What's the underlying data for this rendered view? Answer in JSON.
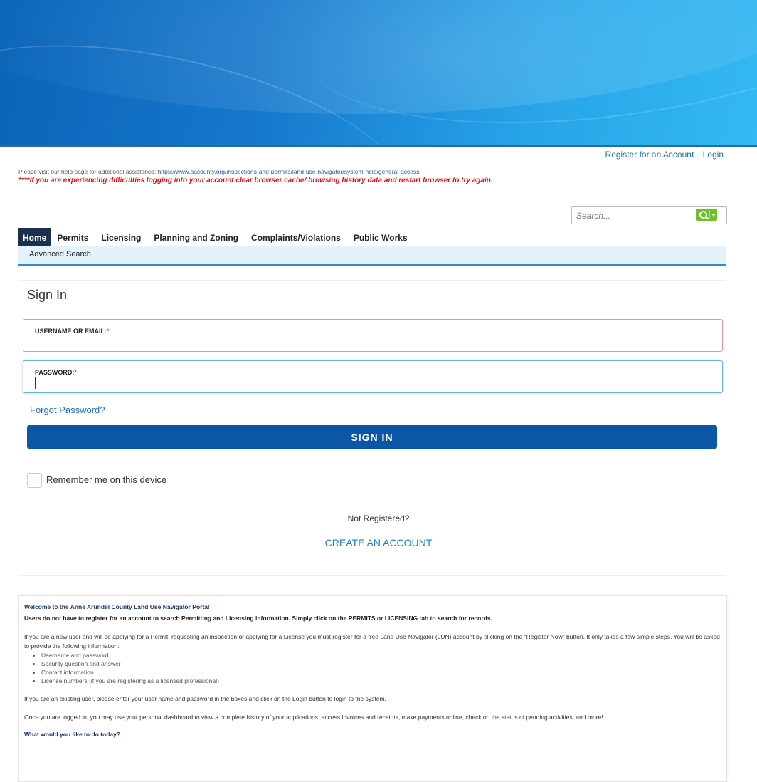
{
  "header": {
    "register_link": "Register for an Account",
    "login_link": "Login"
  },
  "help": {
    "text": "Please visit our help page for additional assistance:",
    "url_text": "https://www.aacounty.org/inspections-and-permits/land-use-navigator/system-help/general-access",
    "warning": "****If you are experiencing difficulties logging into your account clear browser cache/ browsing history data and restart browser to try again."
  },
  "search": {
    "placeholder": "Search...",
    "button_icon": "search-icon"
  },
  "nav": {
    "tabs": [
      {
        "label": "Home",
        "active": true
      },
      {
        "label": "Permits",
        "active": false
      },
      {
        "label": "Licensing",
        "active": false
      },
      {
        "label": "Planning and Zoning",
        "active": false
      },
      {
        "label": "Complaints/Violations",
        "active": false
      },
      {
        "label": "Public Works",
        "active": false
      }
    ],
    "subnav_item": "Advanced Search"
  },
  "signin": {
    "title": "Sign In",
    "username_label": "USERNAME OR EMAIL:",
    "password_label": "PASSWORD:",
    "required_mark": "*",
    "username_value": "",
    "password_value": "",
    "forgot_link": "Forgot Password?",
    "button_label": "SIGN IN",
    "remember_label": "Remember me on this device",
    "remember_checked": false,
    "not_registered": "Not Registered?",
    "create_account": "CREATE AN ACCOUNT"
  },
  "welcome": {
    "title": "Welcome to the Anne Arundel County Land Use Navigator Portal",
    "subtitle": "Users do not have to register for an account to search Permitting and Licensing information.  Simply click on the PERMITS or LICENSING tab to search for records.",
    "para1": "If you are a new user and will be applying for a Permit, requesting an inspection or applying for a License you must register for a free Land Use Navigator (LUN) account by clicking on the \"Register Now\" button. It only takes a few simple steps. You will be asked to provide the following information:",
    "list": [
      "Username and password",
      "Security question and answer",
      "Contact information",
      "License numbers (if you are registering as a licensed professional)"
    ],
    "para2": "If you are an existing user, please enter your user name and password in the boxes and click on the Login button to login to the system.",
    "para3": "Once you are logged in, you may use your personal dashboard to view a complete history of your applications, access invoices and receipts, make payments online, check on the status of pending activities, and more!",
    "question": "What would you like to do today?"
  },
  "colors": {
    "banner_start": "#0a63b8",
    "banner_end": "#35b9f2",
    "link": "#1a6fb5",
    "nav_active": "#1b2f4e",
    "signin_button": "#0c56a6",
    "warning": "#e01010",
    "search_button": "#6fbf2a"
  }
}
